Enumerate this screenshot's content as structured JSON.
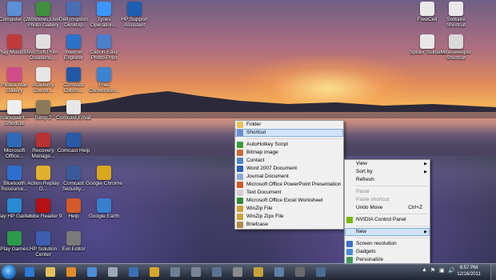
{
  "desktop_icons": [
    {
      "label": "Computer (2)",
      "color": "#5b8fd6"
    },
    {
      "label": "Windows Live Photo Gallery",
      "color": "#3f8f3f"
    },
    {
      "label": "Dell Inspiron Desktop",
      "color": "#4a6fb5"
    },
    {
      "label": "Tynes Operation...",
      "color": "#3b96ff"
    },
    {
      "label": "HP Support Assistant",
      "color": "#1d5fb1"
    },
    {
      "label": "Play MusicBR",
      "color": "#c23b3b"
    },
    {
      "label": "ArcSoft Print Creations ...",
      "color": "#e0e0e0"
    },
    {
      "label": "Internet Explorer",
      "color": "#2a72c8"
    },
    {
      "label": "Canon Easy Photo-Print",
      "color": "#4a7fc9"
    },
    {
      "label": "Picasa Ivan Gallery",
      "color": "#cf4b8c"
    },
    {
      "label": "Academy Countr...",
      "color": "#e6e6e6"
    },
    {
      "label": "Comcast Cutom...",
      "color": "#2357a7"
    },
    {
      "label": "Free Conversion...",
      "color": "#3a84d1"
    },
    {
      "label": "manupaint... Shortcut",
      "color": "#eeeeee"
    },
    {
      "label": "Gimp 2",
      "color": "#8b7a5a"
    },
    {
      "label": "Comcast Email",
      "color": "#e7e7e7"
    },
    {
      "label": "Microsoft Office...",
      "color": "#2e6bb6"
    },
    {
      "label": "Recovery Manage...",
      "color": "#b83232"
    },
    {
      "label": "Comcast Help",
      "color": "#2a5aa8"
    },
    {
      "label": "Bluetooth Resource...",
      "color": "#2c6fd1"
    },
    {
      "label": "Action Replay D...",
      "color": "#e0b12f"
    },
    {
      "label": "Comcast Security...",
      "color": "#3a5a9a"
    },
    {
      "label": "Google Chrome",
      "color": "#d8a81f"
    },
    {
      "label": "Play HP Games",
      "color": "#2a8ad1"
    },
    {
      "label": "Adobe Reader 9",
      "color": "#b31212"
    },
    {
      "label": "Help",
      "color": "#d55a2a"
    },
    {
      "label": "Google Earth",
      "color": "#3a7fd0"
    },
    {
      "label": "Play Games",
      "color": "#2b9a4a"
    },
    {
      "label": "HP Solution Center",
      "color": "#3b5fb0"
    },
    {
      "label": "Evil Editor",
      "color": "#7a7a7a"
    },
    {
      "label": "FreeCell",
      "color": "#e8e8e8"
    },
    {
      "label": "Solitaire Shortcut",
      "color": "#e8e8e8"
    },
    {
      "label": "Spider Solitaire",
      "color": "#e8e8e8"
    },
    {
      "label": "Minesweeper Shortcut",
      "color": "#d9d9d9"
    }
  ],
  "new_submenu": {
    "items": [
      {
        "label": "Folder",
        "icon": "folder-icon",
        "color": "#e8c25a"
      },
      {
        "label": "Shortcut",
        "icon": "shortcut-icon",
        "color": "#6b8fd0",
        "highlighted": true
      },
      {
        "label": "AutoHotkey Script",
        "icon": "ahk-icon",
        "color": "#3c9a3c"
      },
      {
        "label": "Bitmap image",
        "icon": "bitmap-icon",
        "color": "#c96a3b"
      },
      {
        "label": "Contact",
        "icon": "contact-icon",
        "color": "#4d86c9"
      },
      {
        "label": "Word 2007 Document",
        "icon": "word-icon",
        "color": "#2b5fb0"
      },
      {
        "label": "Journal Document",
        "icon": "journal-icon",
        "color": "#8aa9d8"
      },
      {
        "label": "Microsoft Office PowerPoint Presentation",
        "icon": "powerpoint-icon",
        "color": "#d2582b"
      },
      {
        "label": "Text Document",
        "icon": "text-doc-icon",
        "color": "#cfcfcf"
      },
      {
        "label": "Microsoft Office Excel Worksheet",
        "icon": "excel-icon",
        "color": "#2f8a3a"
      },
      {
        "label": "WinZip File",
        "icon": "winzip-icon",
        "color": "#c9a23a"
      },
      {
        "label": "WinZip Zipx File",
        "icon": "winzipx-icon",
        "color": "#c9a23a"
      },
      {
        "label": "Briefcase",
        "icon": "briefcase-icon",
        "color": "#b08b45"
      }
    ]
  },
  "context_menu": {
    "group1": [
      {
        "label": "View",
        "submenu": true
      },
      {
        "label": "Sort by",
        "submenu": true
      },
      {
        "label": "Refresh"
      }
    ],
    "group2": [
      {
        "label": "Paste",
        "disabled": true
      },
      {
        "label": "Paste shortcut",
        "disabled": true
      },
      {
        "label": "Undo Move",
        "shortcut": "Ctrl+Z"
      }
    ],
    "group3": [
      {
        "label": "NVIDIA Control Panel",
        "icon": "nvidia-icon",
        "color": "#76b900"
      }
    ],
    "group4": [
      {
        "label": "New",
        "submenu": true,
        "highlighted": true
      }
    ],
    "group5": [
      {
        "label": "Screen resolution",
        "icon": "screen-resolution-icon",
        "color": "#3a6fc9"
      },
      {
        "label": "Gadgets",
        "icon": "gadgets-icon",
        "color": "#4a8ad8"
      },
      {
        "label": "Personalize",
        "icon": "personalize-icon",
        "color": "#3f9a5a"
      }
    ]
  },
  "submenu_arrow": "▶",
  "taskbar": {
    "pinned": [
      {
        "name": "internet-explorer-icon",
        "color": "#2a7ad6"
      },
      {
        "name": "windows-explorer-icon",
        "color": "#e3c05a"
      },
      {
        "name": "media-player-icon",
        "color": "#e08a2a"
      },
      {
        "name": "checkmark-app-icon",
        "color": "#4f8fd6"
      },
      {
        "name": "pen-tool-icon",
        "color": "#9aa7b8"
      },
      {
        "name": "document-icon",
        "color": "#3b6fb5"
      },
      {
        "name": "chrome-icon",
        "color": "#d9a52a"
      },
      {
        "name": "app-icon-8",
        "color": "#6e7f94"
      },
      {
        "name": "app-icon-9",
        "color": "#7a8697"
      },
      {
        "name": "app-icon-10",
        "color": "#59738f"
      },
      {
        "name": "app-icon-11",
        "color": "#8a8a8a"
      },
      {
        "name": "app-icon-12",
        "color": "#c9a33a"
      },
      {
        "name": "app-icon-13",
        "color": "#5e7fa8"
      },
      {
        "name": "app-icon-14",
        "color": "#6a6a6a"
      },
      {
        "name": "app-icon-15",
        "color": "#4b6c92"
      }
    ],
    "tray_symbols": [
      "▲",
      "⚑",
      "▣",
      "🔊"
    ],
    "time": "6:57 PM",
    "date": "12/16/2011"
  }
}
